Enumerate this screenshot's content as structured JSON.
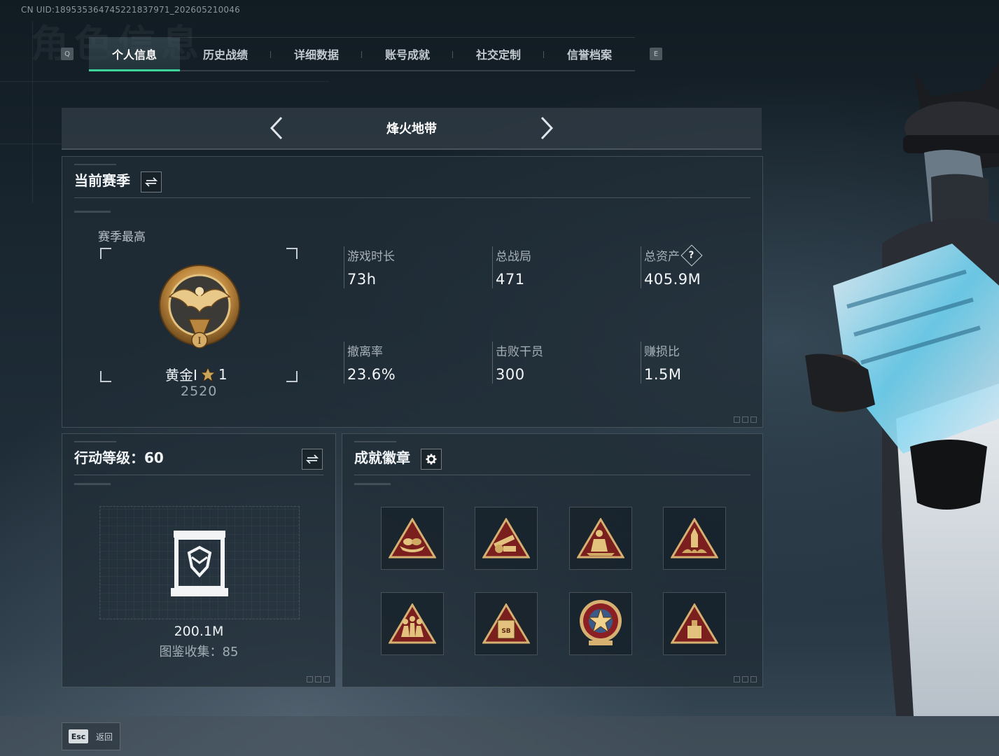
{
  "uid_text": "CN UID:1895353647452218379​71_202605210046",
  "header": {
    "ghost_title": "角色信息",
    "left_key": "Q",
    "right_key": "E",
    "tabs": [
      {
        "label": "个人信息",
        "active": true
      },
      {
        "label": "历史战绩",
        "active": false
      },
      {
        "label": "详细数据",
        "active": false
      },
      {
        "label": "账号成就",
        "active": false
      },
      {
        "label": "社交定制",
        "active": false
      },
      {
        "label": "信誉档案",
        "active": false
      }
    ]
  },
  "mode_selector": {
    "title": "烽火地带"
  },
  "season": {
    "title": "当前赛季",
    "best_label": "赛季最高",
    "rank_name": "黄金I",
    "rank_stars": "1",
    "rank_score": "2520",
    "stats": [
      {
        "label": "游戏时长",
        "value": "73h"
      },
      {
        "label": "总战局",
        "value": "471"
      },
      {
        "label": "总资产",
        "value": "405.9M",
        "help": "?"
      },
      {
        "label": "撤离率",
        "value": "23.6%"
      },
      {
        "label": "击败干员",
        "value": "300"
      },
      {
        "label": "赚损比",
        "value": "1.5M"
      }
    ]
  },
  "operation_level": {
    "title": "行动等级：60",
    "value": "200.1M",
    "collection": "图鉴收集：85"
  },
  "achievements": {
    "title": "成就徽章",
    "badges": [
      {
        "icon": "boat-badge-icon"
      },
      {
        "icon": "cannon-badge-icon"
      },
      {
        "icon": "kneeling-soldier-badge-icon"
      },
      {
        "icon": "rocket-badge-icon"
      },
      {
        "icon": "squad-badge-icon"
      },
      {
        "icon": "safe-badge-icon",
        "text": "SB"
      },
      {
        "icon": "star-emblem-badge-icon"
      },
      {
        "icon": "crate-badge-icon"
      }
    ]
  },
  "footer": {
    "esc_key": "Esc",
    "back_label": "返回"
  },
  "colors": {
    "accent": "#3bd39a",
    "gold": "#c79a4a",
    "badge_red": "#7a1e1e"
  }
}
